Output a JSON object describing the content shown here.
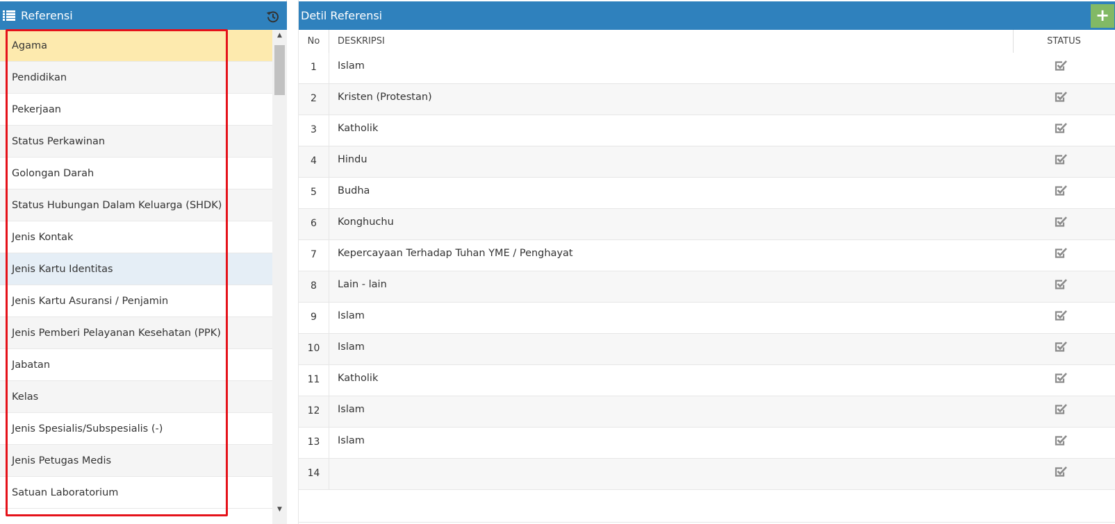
{
  "left_panel": {
    "title": "Referensi",
    "items": [
      {
        "label": "Agama"
      },
      {
        "label": "Pendidikan"
      },
      {
        "label": "Pekerjaan"
      },
      {
        "label": "Status Perkawinan"
      },
      {
        "label": "Golongan Darah"
      },
      {
        "label": "Status Hubungan Dalam Keluarga (SHDK)"
      },
      {
        "label": "Jenis Kontak"
      },
      {
        "label": "Jenis Kartu Identitas"
      },
      {
        "label": "Jenis Kartu Asuransi / Penjamin"
      },
      {
        "label": "Jenis Pemberi Pelayanan Kesehatan (PPK)"
      },
      {
        "label": "Jabatan"
      },
      {
        "label": "Kelas"
      },
      {
        "label": "Jenis Spesialis/Subspesialis (-)"
      },
      {
        "label": "Jenis Petugas Medis"
      },
      {
        "label": "Satuan Laboratorium"
      }
    ],
    "selected_item": "Agama",
    "hovered_item": "Jenis Kartu Identitas"
  },
  "right_panel": {
    "title": "Detil Referensi",
    "add_button_label": "+",
    "columns": {
      "no": "No",
      "description": "DESKRIPSI",
      "status": "STATUS"
    },
    "rows": [
      {
        "no": "1",
        "description": "Islam",
        "status": true
      },
      {
        "no": "2",
        "description": "Kristen (Protestan)",
        "status": true
      },
      {
        "no": "3",
        "description": "Katholik",
        "status": true
      },
      {
        "no": "4",
        "description": "Hindu",
        "status": true
      },
      {
        "no": "5",
        "description": "Budha",
        "status": true
      },
      {
        "no": "6",
        "description": "Konghuchu",
        "status": true
      },
      {
        "no": "7",
        "description": "Kepercayaan Terhadap Tuhan YME / Penghayat",
        "status": true
      },
      {
        "no": "8",
        "description": "Lain - lain",
        "status": true
      },
      {
        "no": "9",
        "description": "Islam",
        "status": true
      },
      {
        "no": "10",
        "description": "Islam",
        "status": true
      },
      {
        "no": "11",
        "description": "Katholik",
        "status": true
      },
      {
        "no": "12",
        "description": "Islam",
        "status": true
      },
      {
        "no": "13",
        "description": "Islam",
        "status": true
      },
      {
        "no": "14",
        "description": "",
        "status": true
      }
    ]
  },
  "icons": {
    "list": "list-icon",
    "history": "history-icon",
    "add": "plus-icon",
    "status": "checkbox-checked-icon",
    "scroll_up": "scroll-up-arrow-icon",
    "scroll_down": "scroll-down-arrow-icon"
  },
  "colors": {
    "header_bg": "#2f81bd",
    "selected_bg": "#fdeaae",
    "hover_bg": "#e5eef6",
    "add_button_bg": "#82b965",
    "highlight_border": "#e5121a",
    "check_icon": "#8a8a8a"
  }
}
